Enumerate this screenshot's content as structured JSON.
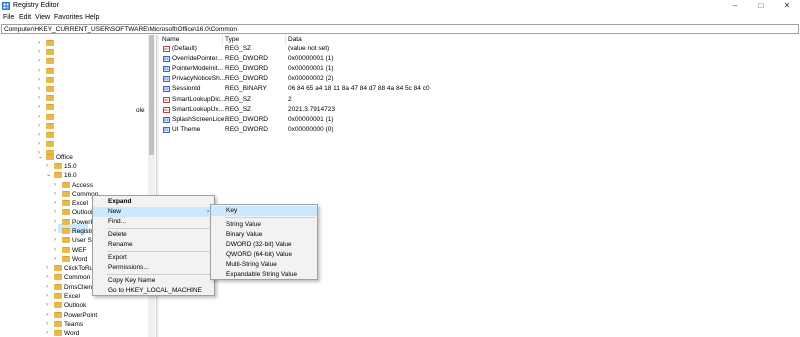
{
  "window": {
    "title": "Registry Editor",
    "controls": {
      "minimize": "–",
      "maximize": "□",
      "close": "✕"
    }
  },
  "menubar": [
    "File",
    "Edit",
    "View",
    "Favorites",
    "Help"
  ],
  "address": "Computer\\HKEY_CURRENT_USER\\SOFTWARE\\Microsoft\\Office\\16.0\\Common",
  "tree": {
    "stray_text": "ole",
    "office": "Office",
    "v15": "15.0",
    "v16": "16.0",
    "children16": [
      "Access",
      "Common",
      "Excel",
      "Outlook",
      "PowerPoint",
      "Registration",
      "User Settings",
      "WEF",
      "Word"
    ],
    "officeChildren": [
      "ClickToRun",
      "Common",
      "DmsClient",
      "Excel",
      "Outlook",
      "PowerPoint",
      "Teams",
      "Word"
    ]
  },
  "list": {
    "headers": {
      "name": "Name",
      "type": "Type",
      "data": "Data"
    },
    "rows": [
      {
        "name": "(Default)",
        "type": "REG_SZ",
        "data": "(value not set)",
        "kind": "sz"
      },
      {
        "name": "OverridePointer...",
        "type": "REG_DWORD",
        "data": "0x00000001 (1)",
        "kind": "bin"
      },
      {
        "name": "PointerModeInit...",
        "type": "REG_DWORD",
        "data": "0x00000001 (1)",
        "kind": "bin"
      },
      {
        "name": "PrivacyNoticeSh...",
        "type": "REG_DWORD",
        "data": "0x00000002 (2)",
        "kind": "bin"
      },
      {
        "name": "SessionId",
        "type": "REG_BINARY",
        "data": "06 84 65 a4 18 11 8a 47 84 d7 88 4a 84 5c 84 c0",
        "kind": "bin"
      },
      {
        "name": "SmartLookupDic...",
        "type": "REG_SZ",
        "data": "2",
        "kind": "sz"
      },
      {
        "name": "SmartLookupUx...",
        "type": "REG_SZ",
        "data": "2021.3.7914723",
        "kind": "sz"
      },
      {
        "name": "SplashScreenLice...",
        "type": "REG_DWORD",
        "data": "0x00000001 (1)",
        "kind": "bin"
      },
      {
        "name": "UI Theme",
        "type": "REG_DWORD",
        "data": "0x00000000 (0)",
        "kind": "bin"
      }
    ]
  },
  "context_menu": {
    "expand": "Expand",
    "new": "New",
    "find": "Find...",
    "delete": "Delete",
    "rename": "Rename",
    "export": "Export",
    "permissions": "Permissions...",
    "copy_key_name": "Copy Key Name",
    "goto": "Go to HKEY_LOCAL_MACHINE"
  },
  "submenu": {
    "key": "Key",
    "string": "String Value",
    "binary": "Binary Value",
    "dword": "DWORD (32-bit) Value",
    "qword": "QWORD (64-bit) Value",
    "multi": "Multi-String Value",
    "expandable": "Expandable String Value"
  }
}
